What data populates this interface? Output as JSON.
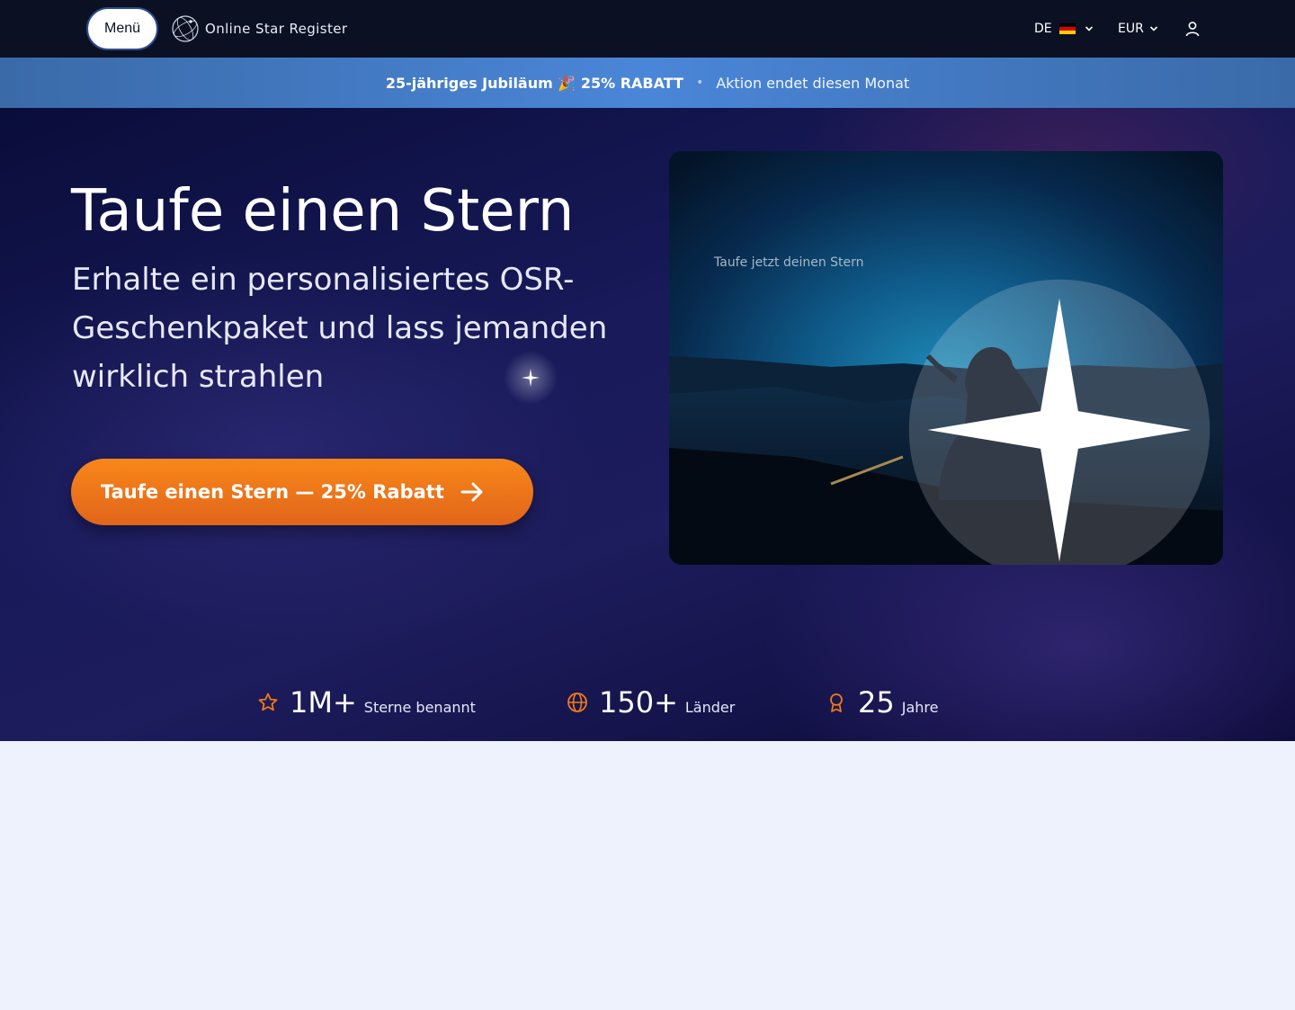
{
  "nav": {
    "menu_label": "Menü",
    "logo_text": "Online Star Register",
    "language": "DE",
    "currency": "EUR"
  },
  "promo": {
    "highlight": "25-jähriges Jubiläum 🎉 25% RABATT",
    "separator": "•",
    "message": "Aktion endet diesen Monat"
  },
  "hero": {
    "title": "Taufe einen Stern",
    "subtitle": "Erhalte ein personalisiertes OSR-Geschenkpaket und lass jemanden wirklich strahlen",
    "cta_label": "Taufe einen Stern — 25% Rabatt",
    "image_caption": "Taufe jetzt deinen Stern"
  },
  "stats": [
    {
      "icon": "star-icon",
      "number": "1M+",
      "label": "Sterne benannt"
    },
    {
      "icon": "globe-icon",
      "number": "150+",
      "label": "Länder"
    },
    {
      "icon": "award-icon",
      "number": "25",
      "label": "Jahre"
    }
  ],
  "colors": {
    "accent": "#f07a18",
    "nav_bg": "#0b1122",
    "promo_bg": "#4a86d8",
    "page_bg": "#eef2fc"
  }
}
